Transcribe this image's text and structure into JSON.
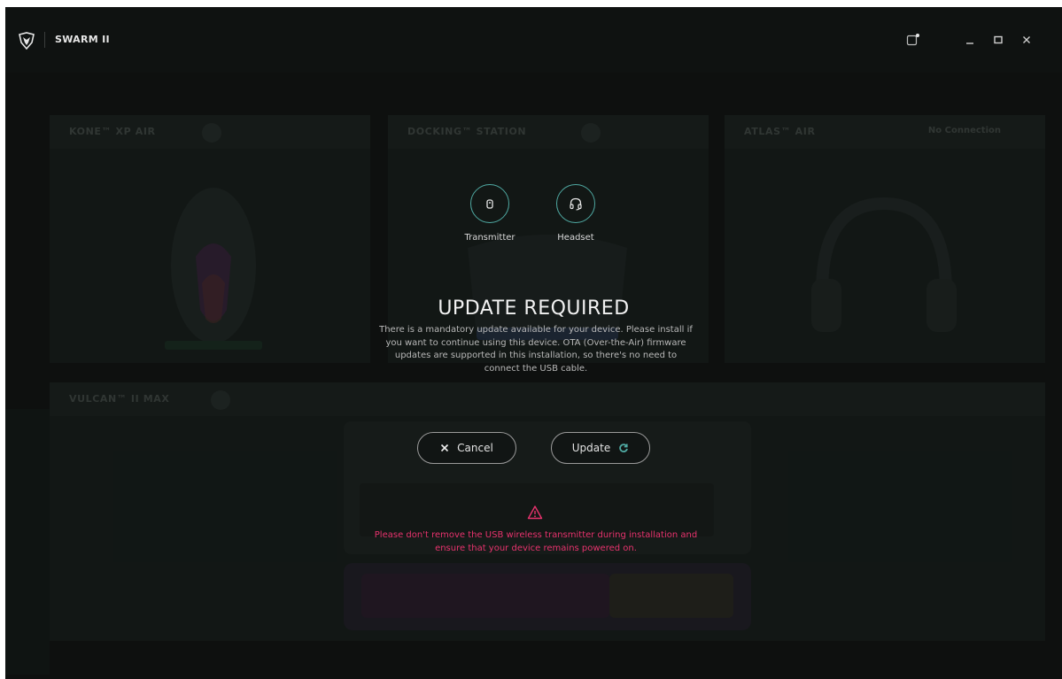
{
  "app": {
    "title": "SWARM II"
  },
  "background": {
    "tiles": [
      {
        "name": "KONE™ XP AIR",
        "status": ""
      },
      {
        "name": "DOCKING™ STATION",
        "status": ""
      },
      {
        "name": "ATLAS™ AIR",
        "status": "No Connection"
      },
      {
        "name": "VULCAN™ II MAX",
        "status": ""
      }
    ]
  },
  "modal": {
    "devices": [
      {
        "label": "Transmitter",
        "icon": "usb-transmitter-icon"
      },
      {
        "label": "Headset",
        "icon": "headset-icon"
      }
    ],
    "headline": "UPDATE REQUIRED",
    "body": "There is a mandatory update available for your device. Please install if you want to continue using this device. OTA (Over-the-Air) firmware updates are supported in this installation, so there's no need to connect the USB cable.",
    "cancel_label": "Cancel",
    "update_label": "Update",
    "warning": "Please don't remove the USB wireless transmitter during installation and ensure that your device remains powered on."
  },
  "colors": {
    "accent": "#4fa9a2",
    "warning": "#e8336e",
    "background": "#0f1211"
  }
}
